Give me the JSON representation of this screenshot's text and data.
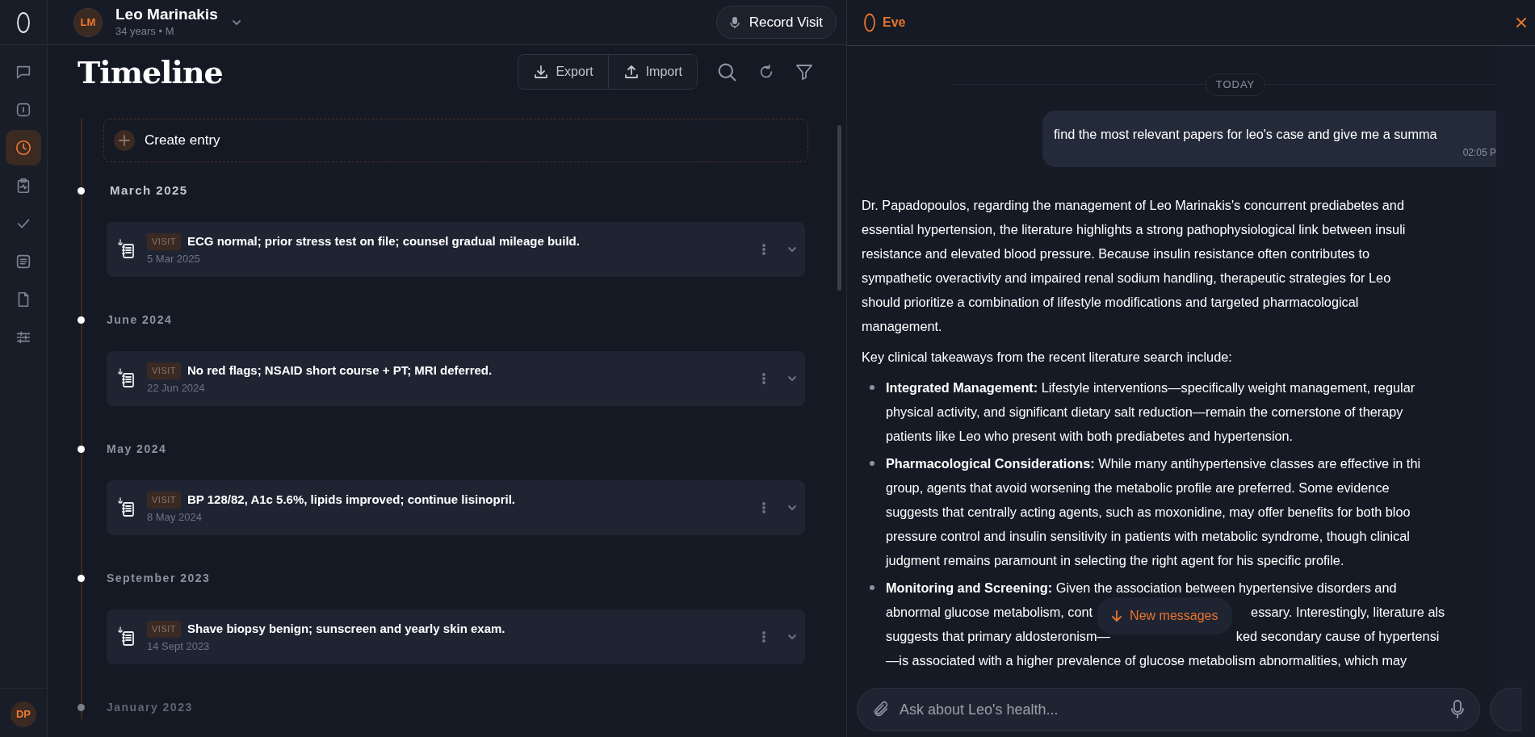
{
  "sidebar": {
    "items": [
      {
        "selected": false
      },
      {
        "selected": false
      },
      {
        "selected": true
      },
      {
        "selected": false
      },
      {
        "selected": false
      },
      {
        "selected": false
      },
      {
        "selected": false
      },
      {
        "selected": false
      }
    ],
    "user_initials": "DP"
  },
  "patient": {
    "initials": "LM",
    "name": "Leo Marinakis",
    "details": "34 years • M"
  },
  "record_button": "Record Visit",
  "timeline": {
    "title": "Timeline",
    "actions": [
      "Export",
      "Import"
    ],
    "create_label": "Create entry",
    "groups": [
      {
        "month": "March 2025",
        "entries": [
          {
            "tag": "VISIT",
            "summary": "ECG normal; prior stress test on file; counsel gradual mileage build.",
            "date": "5 Mar 2025"
          }
        ]
      },
      {
        "month": "June 2024",
        "entries": [
          {
            "tag": "VISIT",
            "summary": "No red flags; NSAID short course + PT; MRI deferred.",
            "date": "22 Jun 2024"
          }
        ]
      },
      {
        "month": "May 2024",
        "entries": [
          {
            "tag": "VISIT",
            "summary": "BP 128/82, A1c 5.6%, lipids improved; continue lisinopril.",
            "date": "8 May 2024"
          }
        ]
      },
      {
        "month": "September 2023",
        "entries": [
          {
            "tag": "VISIT",
            "summary": "Shave biopsy benign; sunscreen and yearly skin exam.",
            "date": "14 Sept 2023"
          }
        ]
      },
      {
        "month": "January 2023"
      }
    ]
  },
  "assistant": {
    "name": "Eve",
    "day_label": "TODAY",
    "user_message": {
      "text": "find the most relevant papers for leo's case and give me a summa",
      "time": "02:05 P"
    },
    "reply": [
      {
        "kind": "paragraph",
        "lines": [
          "Dr. Papadopoulos, regarding the management of Leo Marinakis's concurrent prediabetes and",
          "essential hypertension, the literature highlights a strong pathophysiological link between insuli",
          "resistance and elevated blood pressure. Because insulin resistance often contributes to",
          "sympathetic overactivity and impaired renal sodium handling, therapeutic strategies for Leo",
          "should prioritize a combination of lifestyle modifications and targeted pharmacological",
          "management."
        ]
      },
      {
        "kind": "paragraph",
        "lines": [
          "Key clinical takeaways from the recent literature search include:"
        ]
      },
      {
        "kind": "bullets",
        "items": [
          {
            "lines": [
              "**Integrated Management:** Lifestyle interventions—specifically weight management, regular",
              "physical activity, and significant dietary salt reduction—remain the cornerstone of therapy",
              "patients like Leo who present with both prediabetes and hypertension."
            ]
          },
          {
            "lines": [
              "**Pharmacological Considerations:** While many antihypertensive classes are effective in thi",
              "group, agents that avoid worsening the metabolic profile are preferred. Some evidence",
              "suggests that centrally acting agents, such as moxonidine, may offer benefits for both bloo",
              "pressure control and insulin sensitivity in patients with metabolic syndrome, though clinical",
              "judgment remains paramount in selecting the right agent for his specific profile."
            ]
          },
          {
            "lines": [
              "**Monitoring and Screening:** Given the association between hypertensive disorders and",
              {
                "left": "abnormal glucose metabolism, cont",
                "right": "essary. Interestingly, literature als"
              },
              {
                "left": "suggests that primary aldosteronism—",
                "right": "ked secondary cause of hypertensi"
              },
              "—is associated with a higher prevalence of glucose metabolism abnormalities, which may"
            ]
          }
        ]
      }
    ],
    "new_messages": "New messages",
    "input": {
      "placeholder": "Ask about Leo's health..."
    }
  }
}
